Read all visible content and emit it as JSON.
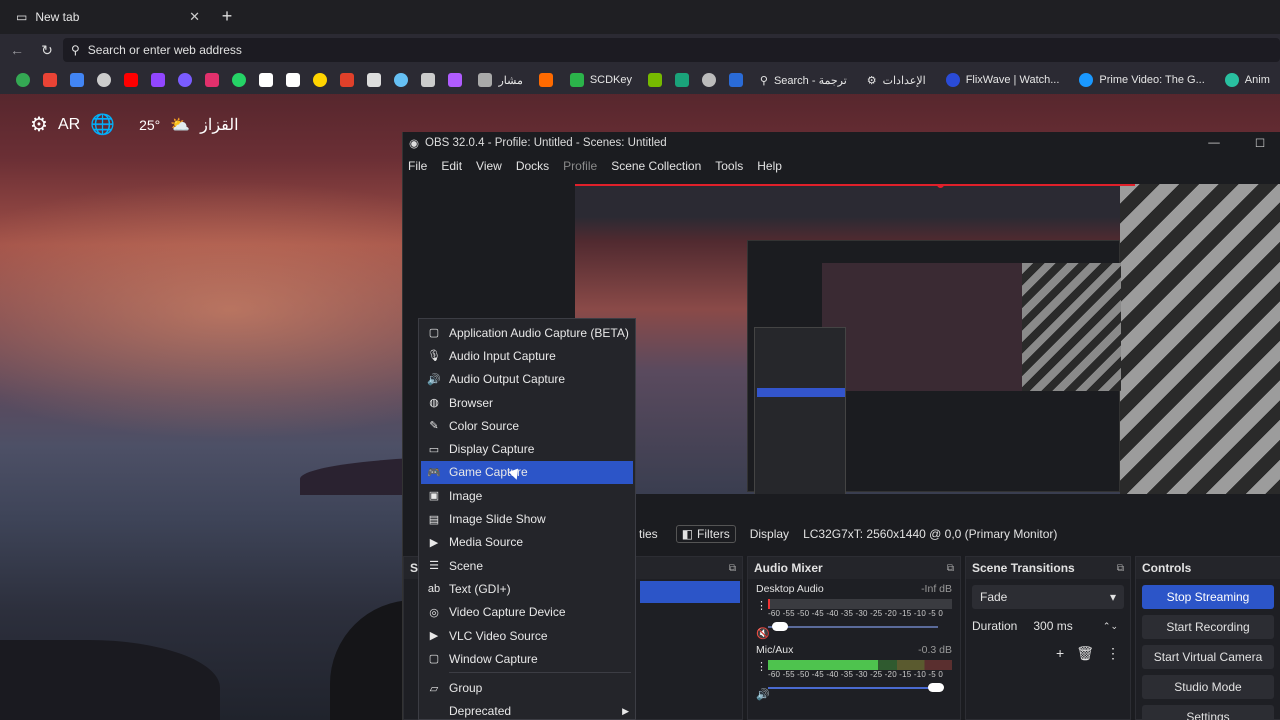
{
  "browser": {
    "tab_title": "New tab",
    "tab_close": "✕",
    "new_tab": "+",
    "back": "←",
    "reload": "↻",
    "url_placeholder": "Search or enter web address",
    "bookmarks": [
      {
        "label": "SCDKey",
        "color": "#2bb34a"
      },
      {
        "label": "Search - ترجمة",
        "color": "#8ab4f8"
      },
      {
        "label": "الإعدادات",
        "color": "#bbb"
      },
      {
        "label": "FlixWave | Watch...",
        "color": "#2a4bd7"
      },
      {
        "label": "Prime Video: The G...",
        "color": "#1a98ff"
      },
      {
        "label": "Anim",
        "color": "#29c0a0"
      }
    ],
    "mshaar": "مشار"
  },
  "widget": {
    "lang": "AR",
    "temp": "25°",
    "city": "القزاز"
  },
  "obs": {
    "title": "OBS 32.0.4 - Profile: Untitled - Scenes: Untitled",
    "menu": [
      "File",
      "Edit",
      "View",
      "Docks",
      "Profile",
      "Scene Collection",
      "Tools",
      "Help"
    ],
    "source_bar": {
      "properties_partial": "ties",
      "filters": "Filters",
      "display_label": "Display",
      "display_value": "LC32G7xT: 2560x1440 @ 0,0 (Primary Monitor)"
    },
    "scenes_title": "Sc",
    "mixer": {
      "title": "Audio Mixer",
      "channels": [
        {
          "name": "Desktop Audio",
          "db": "-Inf dB",
          "level": 0.0,
          "volume": 0.05
        },
        {
          "name": "Mic/Aux",
          "db": "-0.3 dB",
          "level": 0.6,
          "volume": 0.98
        }
      ],
      "scale": "-60 -55 -50 -45 -40 -35 -30 -25 -20 -15 -10 -5 0"
    },
    "transitions": {
      "title": "Scene Transitions",
      "selected": "Fade",
      "duration_label": "Duration",
      "duration_value": "300 ms"
    },
    "controls": {
      "title": "Controls",
      "buttons": [
        "Stop Streaming",
        "Start Recording",
        "Start Virtual Camera",
        "Studio Mode",
        "Settings"
      ]
    }
  },
  "context_menu": {
    "items": [
      {
        "label": "Application Audio Capture (BETA)",
        "icon": "window-icon"
      },
      {
        "label": "Audio Input Capture",
        "icon": "mic-icon"
      },
      {
        "label": "Audio Output Capture",
        "icon": "speaker-icon"
      },
      {
        "label": "Browser",
        "icon": "globe-icon"
      },
      {
        "label": "Color Source",
        "icon": "brush-icon"
      },
      {
        "label": "Display Capture",
        "icon": "monitor-icon"
      },
      {
        "label": "Game Capture",
        "icon": "gamepad-icon"
      },
      {
        "label": "Image",
        "icon": "image-icon"
      },
      {
        "label": "Image Slide Show",
        "icon": "slideshow-icon"
      },
      {
        "label": "Media Source",
        "icon": "play-icon"
      },
      {
        "label": "Scene",
        "icon": "list-icon"
      },
      {
        "label": "Text (GDI+)",
        "icon": "text-icon"
      },
      {
        "label": "Video Capture Device",
        "icon": "camera-icon"
      },
      {
        "label": "VLC Video Source",
        "icon": "play-icon"
      },
      {
        "label": "Window Capture",
        "icon": "window-icon"
      },
      {
        "label": "Group",
        "icon": "folder-icon"
      },
      {
        "label": "Deprecated",
        "icon": ""
      }
    ],
    "active_index": 6
  }
}
